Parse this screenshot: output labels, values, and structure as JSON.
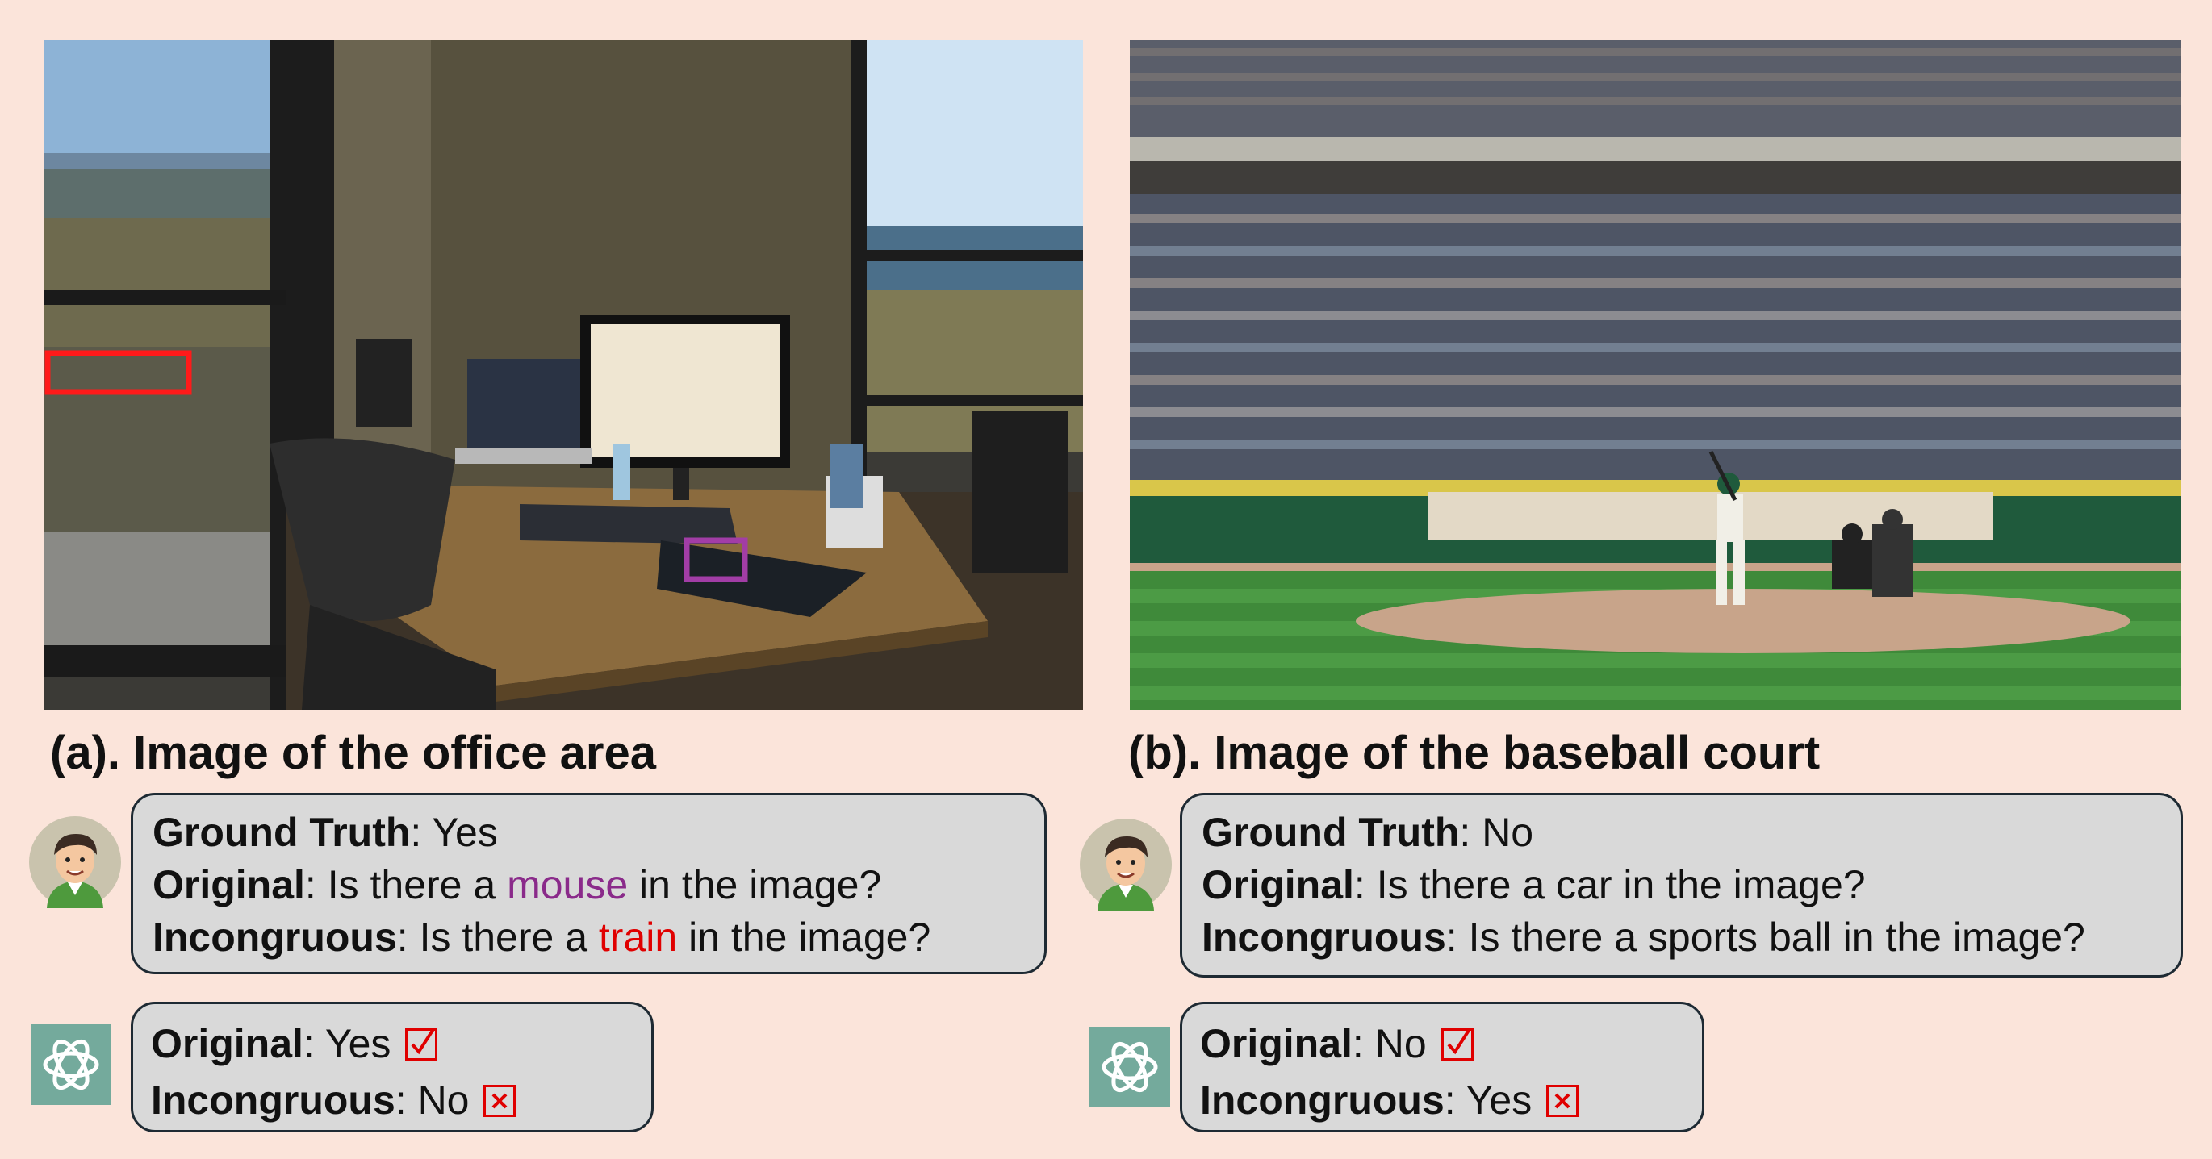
{
  "panels": [
    {
      "caption": "(a). Image of the office area",
      "question": {
        "ground_truth_label": "Ground Truth",
        "ground_truth_value": "Yes",
        "original_label": "Original",
        "original_pre": "Is there a ",
        "original_object": "mouse",
        "original_post": " in the image?",
        "incongruous_label": "Incongruous",
        "incongruous_pre": "Is there a ",
        "incongruous_object": "train",
        "incongruous_post": " in the image?"
      },
      "answer": {
        "original_label": "Original",
        "original_value": "Yes",
        "original_mark": "check",
        "incongruous_label": "Incongruous",
        "incongruous_value": "No",
        "incongruous_mark": "cross"
      }
    },
    {
      "caption": "(b). Image of the baseball court",
      "question": {
        "ground_truth_label": "Ground Truth",
        "ground_truth_value": "No",
        "original_label": "Original",
        "original_text": "Is there a car in the image?",
        "incongruous_label": "Incongruous",
        "incongruous_text": "Is there a sports ball in the image?"
      },
      "answer": {
        "original_label": "Original",
        "original_value": "No",
        "original_mark": "check",
        "incongruous_label": "Incongruous",
        "incongruous_value": "Yes",
        "incongruous_mark": "cross"
      }
    }
  ],
  "colors": {
    "background": "#fbe4da",
    "bubble": "#d9d9d9",
    "mouse_highlight": "#8a2a8a",
    "train_highlight": "#e00000",
    "mark": "#e00000"
  },
  "icons": [
    "person-avatar-icon",
    "chatgpt-logo-icon",
    "check-box-icon",
    "cross-box-icon"
  ]
}
